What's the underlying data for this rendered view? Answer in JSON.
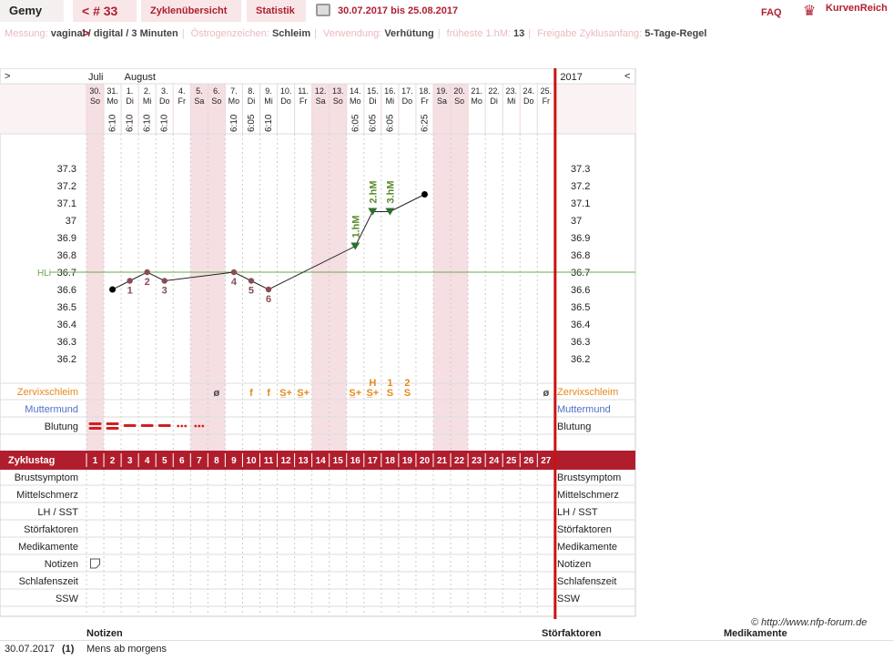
{
  "header": {
    "name": "Gemy",
    "cycle": "< # 33 >",
    "tab_overview": "Zyklenübersicht",
    "tab_stats": "Statistik",
    "date_range": "30.07.2017 bis 25.08.2017",
    "faq": "FAQ",
    "brand": "KurvenReich"
  },
  "settings": [
    {
      "label": "Messung:",
      "value": "vaginal / digital / 3 Minuten"
    },
    {
      "label": "Östrogenzeichen:",
      "value": "Schleim"
    },
    {
      "label": "Verwendung:",
      "value": "Verhütung"
    },
    {
      "label": "früheste 1.hM:",
      "value": "13"
    },
    {
      "label": "Freigabe Zyklusanfang:",
      "value": "5-Tage-Regel"
    }
  ],
  "chart_data": {
    "type": "line",
    "months": [
      "Juli",
      "August"
    ],
    "year": "2017",
    "nav_left": ">",
    "nav_right": "<",
    "days": [
      {
        "d": "30.",
        "w": "So",
        "weekend": true
      },
      {
        "d": "31.",
        "w": "Mo",
        "weekend": false
      },
      {
        "d": "1.",
        "w": "Di",
        "weekend": false
      },
      {
        "d": "2.",
        "w": "Mi",
        "weekend": false
      },
      {
        "d": "3.",
        "w": "Do",
        "weekend": false
      },
      {
        "d": "4.",
        "w": "Fr",
        "weekend": false
      },
      {
        "d": "5.",
        "w": "Sa",
        "weekend": true
      },
      {
        "d": "6.",
        "w": "So",
        "weekend": true
      },
      {
        "d": "7.",
        "w": "Mo",
        "weekend": false
      },
      {
        "d": "8.",
        "w": "Di",
        "weekend": false
      },
      {
        "d": "9.",
        "w": "Mi",
        "weekend": false
      },
      {
        "d": "10.",
        "w": "Do",
        "weekend": false
      },
      {
        "d": "11.",
        "w": "Fr",
        "weekend": false
      },
      {
        "d": "12.",
        "w": "Sa",
        "weekend": true
      },
      {
        "d": "13.",
        "w": "So",
        "weekend": true
      },
      {
        "d": "14.",
        "w": "Mo",
        "weekend": false
      },
      {
        "d": "15.",
        "w": "Di",
        "weekend": false
      },
      {
        "d": "16.",
        "w": "Mi",
        "weekend": false
      },
      {
        "d": "17.",
        "w": "Do",
        "weekend": false
      },
      {
        "d": "18.",
        "w": "Fr",
        "weekend": false
      },
      {
        "d": "19.",
        "w": "Sa",
        "weekend": true
      },
      {
        "d": "20.",
        "w": "So",
        "weekend": true
      },
      {
        "d": "21.",
        "w": "Mo",
        "weekend": false
      },
      {
        "d": "22.",
        "w": "Di",
        "weekend": false
      },
      {
        "d": "23.",
        "w": "Mi",
        "weekend": false
      },
      {
        "d": "24.",
        "w": "Do",
        "weekend": false
      },
      {
        "d": "25.",
        "w": "Fr",
        "weekend": false
      }
    ],
    "times": {
      "2": "6:10",
      "3": "6:10",
      "4": "6:10",
      "5": "6:10",
      "9": "6:10",
      "10": "6:05",
      "11": "6:10",
      "16": "6:05",
      "17": "6:05",
      "18": "6:05",
      "20": "6:25"
    },
    "y_ticks": [
      "37.3",
      "37.2",
      "37.1",
      "37",
      "36.9",
      "36.8",
      "36.7",
      "36.6",
      "36.5",
      "36.4",
      "36.3",
      "36.2"
    ],
    "ylim": [
      36.1,
      37.4
    ],
    "coverline": {
      "label": "HLi",
      "value": 36.7
    },
    "temperatures": [
      {
        "day": 2,
        "value": 36.6,
        "label": "",
        "kind": "dot"
      },
      {
        "day": 3,
        "value": 36.65,
        "label": "1",
        "kind": "low"
      },
      {
        "day": 4,
        "value": 36.7,
        "label": "2",
        "kind": "low"
      },
      {
        "day": 5,
        "value": 36.65,
        "label": "3",
        "kind": "low"
      },
      {
        "day": 9,
        "value": 36.7,
        "label": "4",
        "kind": "low"
      },
      {
        "day": 10,
        "value": 36.65,
        "label": "5",
        "kind": "low"
      },
      {
        "day": 11,
        "value": 36.6,
        "label": "6",
        "kind": "low"
      },
      {
        "day": 16,
        "value": 36.85,
        "label": "1.hM",
        "kind": "high"
      },
      {
        "day": 17,
        "value": 37.05,
        "label": "2.hM",
        "kind": "high"
      },
      {
        "day": 18,
        "value": 37.05,
        "label": "3.hM",
        "kind": "high"
      },
      {
        "day": 20,
        "value": 37.15,
        "label": "",
        "kind": "dot"
      }
    ],
    "peak_markers": {
      "17": "H",
      "18": "1",
      "19": "2"
    },
    "mucus": {
      "8": "ø",
      "10": "f",
      "11": "f",
      "12": "S̲+",
      "13": "S̲+",
      "16": "S̲+",
      "17": "S̲+",
      "18": "S",
      "19": "S",
      "27": "ø"
    },
    "bleeding": {
      "1": "heavy",
      "2": "heavy",
      "3": "medium",
      "4": "medium",
      "5": "medium",
      "6": "spot",
      "7": "spot"
    },
    "rows_mid": [
      "Zervixschleim",
      "Muttermund",
      "Blutung"
    ],
    "cycle_day_label": "Zyklustag",
    "cycle_days": [
      "1",
      "2",
      "3",
      "4",
      "5",
      "6",
      "7",
      "8",
      "9",
      "10",
      "11",
      "12",
      "13",
      "14",
      "15",
      "16",
      "17",
      "18",
      "19",
      "20",
      "21",
      "22",
      "23",
      "24",
      "25",
      "26",
      "27"
    ],
    "rows_bottom": [
      "Brustsymptom",
      "Mittelschmerz",
      "LH / SST",
      "Störfaktoren",
      "Medikamente",
      "Notizen",
      "Schlafenszeit",
      "SSW"
    ],
    "note_day": 1
  },
  "copyright": "© http://www.nfp-forum.de",
  "notes": {
    "col_notes": "Notizen",
    "col_stoer": "Störfaktoren",
    "col_medi": "Medikamente",
    "date": "30.07.2017",
    "day": "(1)",
    "text": "Mens ab morgens"
  },
  "colors": {
    "accent": "#b01e2e",
    "weekend": "#f5dfe2",
    "mucus": "#e38a1a",
    "hm": "#5a8a2a",
    "low": "#8a4b55",
    "coverline": "#6aa84f",
    "muttermund": "#4f6fc6"
  }
}
